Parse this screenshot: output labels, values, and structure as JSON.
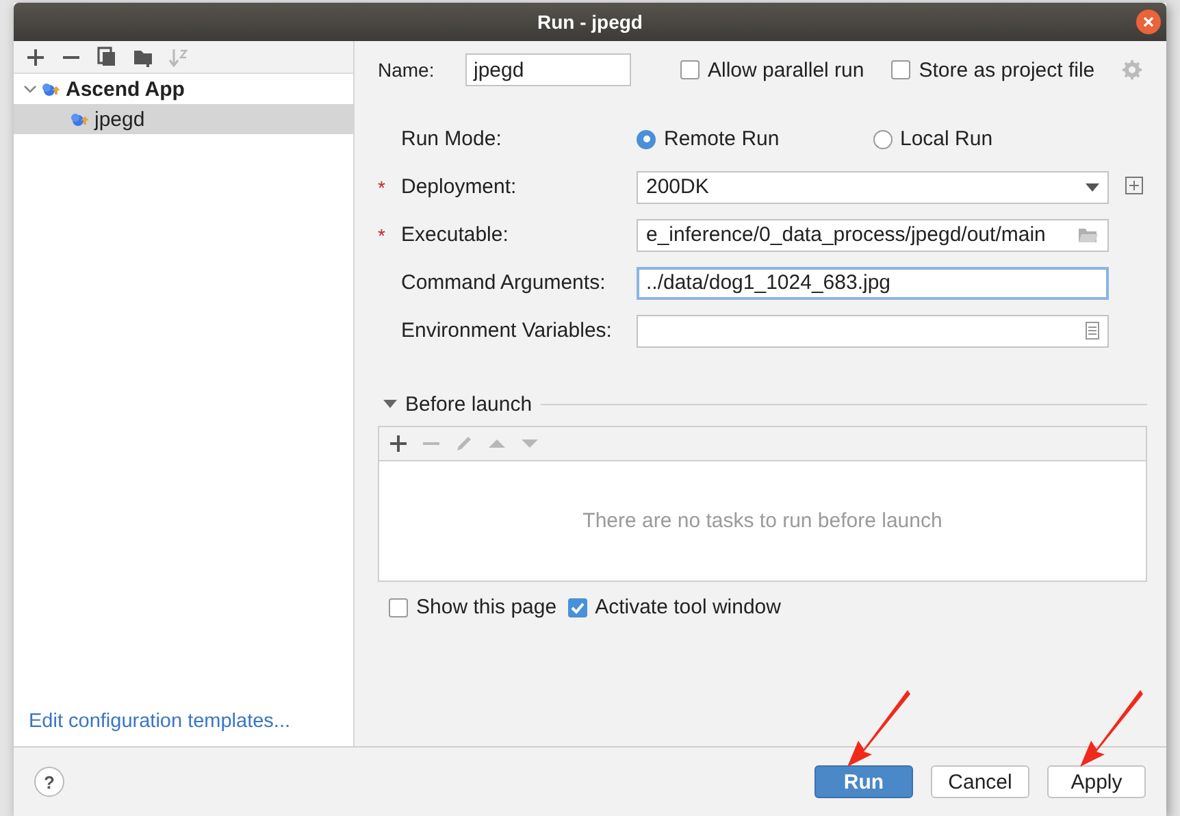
{
  "window": {
    "title": "Run - jpegd"
  },
  "sidebar": {
    "toolbar": [
      {
        "kind": "add",
        "disabled": false
      },
      {
        "kind": "remove",
        "disabled": false
      },
      {
        "kind": "copy",
        "disabled": false
      },
      {
        "kind": "folder",
        "disabled": false
      },
      {
        "kind": "sort",
        "disabled": true
      }
    ],
    "tree": [
      {
        "label": "Ascend App",
        "expanded": true,
        "selected": false,
        "children": [
          {
            "label": "jpegd",
            "selected": true
          }
        ]
      }
    ],
    "link": "Edit configuration templates..."
  },
  "name": {
    "label": "Name:",
    "value": "jpegd"
  },
  "options": [
    {
      "label": "Allow parallel run",
      "checked": false
    },
    {
      "label": "Store as project file",
      "checked": false
    }
  ],
  "run_mode": {
    "label": "Run Mode:",
    "options": [
      {
        "label": "Remote Run",
        "selected": true
      },
      {
        "label": "Local Run",
        "selected": false
      }
    ]
  },
  "fields": [
    {
      "kind": "dropdown",
      "label": "Deployment:",
      "marker": "*",
      "value": "200DK"
    },
    {
      "kind": "path",
      "label": "Executable:",
      "marker": "*",
      "value": "e_inference/0_data_process/jpegd/out/main"
    },
    {
      "kind": "text",
      "label": "Command Arguments:",
      "focused": true,
      "value": "../data/dog1_1024_683.jpg"
    },
    {
      "kind": "env",
      "label": "Environment Variables:",
      "focused": false
    }
  ],
  "before_launch": {
    "title": "Before launch",
    "expanded": true,
    "tools": [
      {
        "kind": "add",
        "disabled": false
      },
      {
        "kind": "remove",
        "disabled": true
      },
      {
        "kind": "edit",
        "disabled": true
      },
      {
        "kind": "up",
        "disabled": true
      },
      {
        "kind": "down",
        "disabled": true
      }
    ],
    "empty_text": "There are no tasks to run before launch"
  },
  "bottom_options": [
    {
      "label": "Show this page",
      "checked": false
    },
    {
      "label": "Activate tool window",
      "checked": true
    }
  ],
  "help": "?",
  "buttons": [
    {
      "label": "Run",
      "primary": true,
      "arrow": true
    },
    {
      "label": "Cancel",
      "primary": false,
      "arrow": false
    },
    {
      "label": "Apply",
      "primary": false,
      "arrow": true
    }
  ]
}
